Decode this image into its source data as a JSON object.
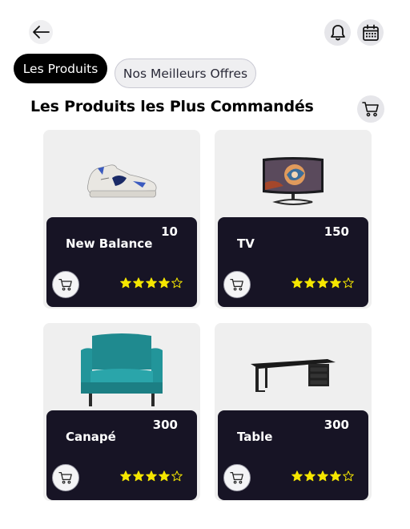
{
  "header": {
    "back_icon": "arrow-left-icon",
    "bell_icon": "bell-icon",
    "calendar_icon": "calendar-icon"
  },
  "tabs": [
    {
      "label": "Les Produits",
      "active": true
    },
    {
      "label": "Nos Meilleurs Offres",
      "active": false
    }
  ],
  "section": {
    "title": "Les Produits les Plus Commandés",
    "cart_icon": "cart-icon"
  },
  "products": [
    {
      "name": "New Balance",
      "price": "10",
      "rating": 4,
      "max_rating": 5,
      "image": "sneaker"
    },
    {
      "name": "TV",
      "price": "150",
      "rating": 4,
      "max_rating": 5,
      "image": "monitor"
    },
    {
      "name": "Canapé",
      "price": "300",
      "rating": 4,
      "max_rating": 5,
      "image": "armchair"
    },
    {
      "name": "Table",
      "price": "300",
      "rating": 4,
      "max_rating": 5,
      "image": "desk"
    }
  ],
  "colors": {
    "panel": "#171425",
    "star": "#f5e600",
    "card_bg": "#efefef"
  }
}
